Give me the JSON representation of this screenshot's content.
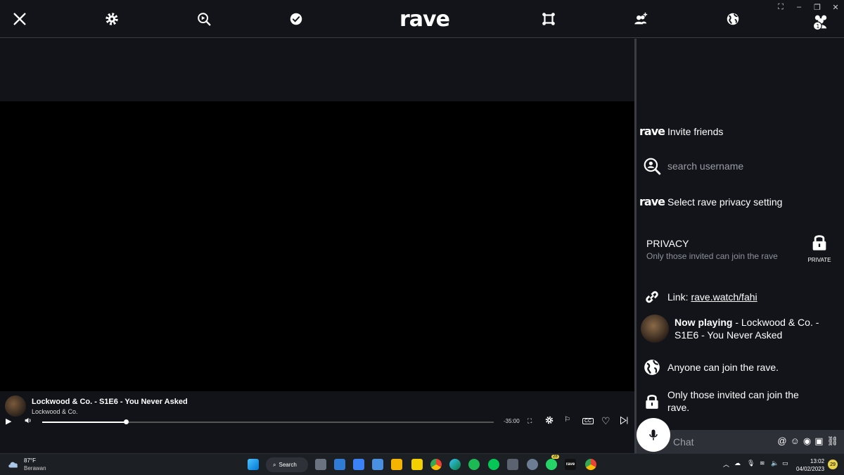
{
  "app": {
    "logo": "rave"
  },
  "panel": {
    "invite_label": "Invite friends",
    "search_placeholder": "search username",
    "privacy_setting_label": "Select rave privacy setting",
    "privacy_title": "PRIVACY",
    "privacy_desc": "Only those invited can join the rave",
    "lock_label": "PRIVATE",
    "link_prefix": "Link: ",
    "link_url": "rave.watch/fahi",
    "now_playing_bold": "Now playing",
    "now_playing_rest": " - Lockwood & Co. - S1E6 - You Never Asked",
    "anyone_label": "Anyone can join the rave.",
    "invited_label": "Only those invited can join the rave."
  },
  "player": {
    "title": "Lockwood & Co. - S1E6 - You Never Asked",
    "subtitle": "Lockwood & Co.",
    "time_remaining": "-35:00",
    "progress": 0.185,
    "cc_label": "CC"
  },
  "chat": {
    "placeholder": "Chat"
  },
  "taskbar": {
    "temperature": "87°F",
    "weather_desc": "Berawan",
    "search_label": "Search",
    "whatsapp_badge": "28",
    "time": "13:02",
    "date": "04/02/2023",
    "notification_count": "29"
  },
  "icons": {
    "topbar": [
      "close-icon",
      "gear-icon",
      "search-play-icon",
      "check-icon",
      "rave-logo",
      "fullscreen-icon",
      "add-user-icon",
      "globe-icon",
      "users-icon"
    ],
    "accent": "#ffffff"
  }
}
